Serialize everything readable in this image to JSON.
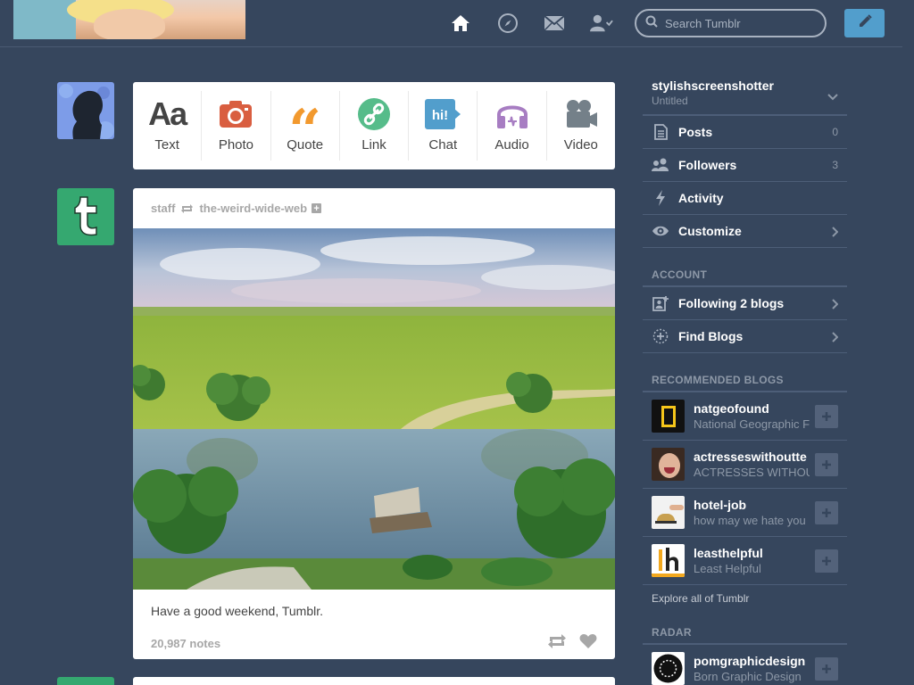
{
  "header": {
    "search_placeholder": "Search Tumblr",
    "accent": "#529ecc"
  },
  "post_types": [
    {
      "label": "Text",
      "icon": "text-icon",
      "color": "#444444"
    },
    {
      "label": "Photo",
      "icon": "camera-icon",
      "color": "#d95e40"
    },
    {
      "label": "Quote",
      "icon": "quote-icon",
      "color": "#f2992e"
    },
    {
      "label": "Link",
      "icon": "link-icon",
      "color": "#56bc8a"
    },
    {
      "label": "Chat",
      "icon": "chat-icon",
      "color": "#529ecc"
    },
    {
      "label": "Audio",
      "icon": "headphones-icon",
      "color": "#a77dc2"
    },
    {
      "label": "Video",
      "icon": "video-camera-icon",
      "color": "#748089"
    }
  ],
  "post": {
    "author": "staff",
    "reblogged_from": "the-weird-wide-web",
    "caption": "Have a good weekend, Tumblr.",
    "notes": "20,987 notes"
  },
  "sidebar": {
    "blog_name": "stylishscreenshotter",
    "blog_title": "Untitled",
    "items": [
      {
        "label": "Posts",
        "count": "0",
        "icon": "posts-icon"
      },
      {
        "label": "Followers",
        "count": "3",
        "icon": "followers-icon"
      },
      {
        "label": "Activity",
        "count": "",
        "icon": "lightning-icon"
      },
      {
        "label": "Customize",
        "count": "",
        "icon": "eye-icon"
      }
    ],
    "account_title": "ACCOUNT",
    "account_items": [
      {
        "label": "Following 2 blogs",
        "icon": "following-icon"
      },
      {
        "label": "Find Blogs",
        "icon": "find-blogs-icon"
      }
    ],
    "recommended_title": "RECOMMENDED BLOGS",
    "recommended": [
      {
        "name": "natgeofound",
        "desc": "National Geographic F"
      },
      {
        "name": "actresseswithoutte",
        "desc": "ACTRESSES WITHOU"
      },
      {
        "name": "hotel-job",
        "desc": "how may we hate you"
      },
      {
        "name": "leasthelpful",
        "desc": "Least Helpful"
      }
    ],
    "explore": "Explore all of Tumblr",
    "radar_title": "RADAR",
    "radar": {
      "name": "pomgraphicdesign",
      "desc": "Born Graphic Design"
    }
  }
}
